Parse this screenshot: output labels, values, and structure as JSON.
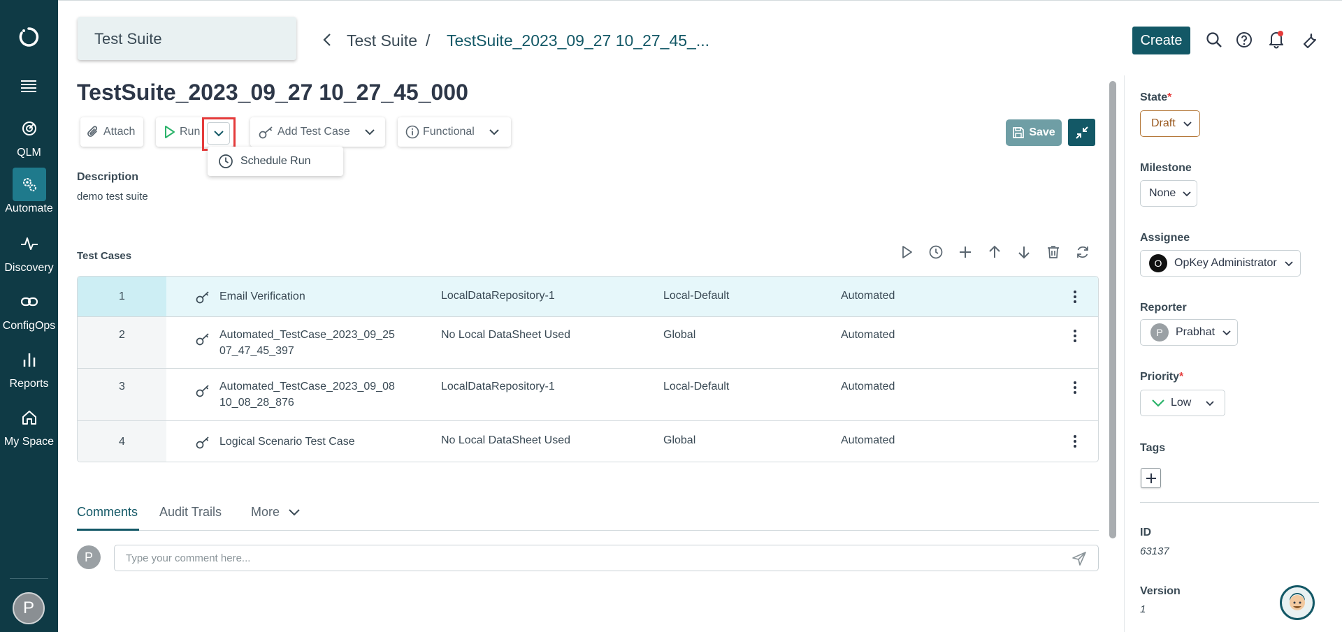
{
  "sidebar": {
    "items": [
      {
        "label": "QLM"
      },
      {
        "label": "Automate"
      },
      {
        "label": "Discovery"
      },
      {
        "label": "ConfigOps"
      },
      {
        "label": "Reports"
      },
      {
        "label": "My Space"
      }
    ],
    "avatar_letter": "P"
  },
  "header": {
    "module": "Test Suite",
    "breadcrumb_parent": "Test Suite",
    "breadcrumb_sep": "/",
    "breadcrumb_current": "TestSuite_2023_09_27 10_27_45_...",
    "create_label": "Create"
  },
  "page": {
    "title": "TestSuite_2023_09_27 10_27_45_000"
  },
  "toolbar": {
    "attach_label": "Attach",
    "run_label": "Run",
    "add_test_case_label": "Add Test Case",
    "functional_label": "Functional",
    "schedule_run_label": "Schedule Run",
    "save_label": "Save"
  },
  "description": {
    "label": "Description",
    "value": "demo test suite"
  },
  "test_cases": {
    "label": "Test Cases",
    "rows": [
      {
        "num": "1",
        "name": "Email Verification",
        "datasheet": "LocalDataRepository-1",
        "env": "Local-Default",
        "type": "Automated"
      },
      {
        "num": "2",
        "name": "Automated_TestCase_2023_09_25 07_47_45_397",
        "datasheet": "No Local DataSheet Used",
        "env": "Global",
        "type": "Automated"
      },
      {
        "num": "3",
        "name": "Automated_TestCase_2023_09_08 10_08_28_876",
        "datasheet": "LocalDataRepository-1",
        "env": "Local-Default",
        "type": "Automated"
      },
      {
        "num": "4",
        "name": "Logical Scenario Test Case",
        "datasheet": "No Local DataSheet Used",
        "env": "Global",
        "type": "Automated"
      }
    ]
  },
  "tabs": {
    "comments": "Comments",
    "audit": "Audit Trails",
    "more": "More"
  },
  "comment": {
    "avatar_letter": "P",
    "placeholder": "Type your comment here..."
  },
  "right_panel": {
    "state_label": "State",
    "state_value": "Draft",
    "milestone_label": "Milestone",
    "milestone_value": "None",
    "assignee_label": "Assignee",
    "assignee_avatar": "O",
    "assignee_value": "OpKey Administrator",
    "reporter_label": "Reporter",
    "reporter_avatar": "P",
    "reporter_value": "Prabhat",
    "priority_label": "Priority",
    "priority_value": "Low",
    "tags_label": "Tags",
    "id_label": "ID",
    "id_value": "63137",
    "version_label": "Version",
    "version_value": "1",
    "required_mark": "*"
  },
  "colors": {
    "sidebar_bg": "#0f3a45",
    "accent": "#135866",
    "highlight": "#e53b3b",
    "priority_low": "#2bb36a"
  }
}
